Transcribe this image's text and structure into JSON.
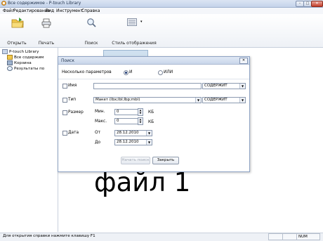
{
  "window": {
    "title": "Все содержимое - P-touch Library"
  },
  "menu": [
    "Файл",
    "Редактирование",
    "Вид",
    "Инструмент",
    "Справка"
  ],
  "toolbar": {
    "open_label": "Открыть",
    "print_label": "Печать",
    "search_label": "Поиск",
    "view_style_label": "Стиль отображения"
  },
  "tree": {
    "root": "P-touch Library",
    "items": [
      "Все содержим",
      "Корзина",
      "Результаты по"
    ]
  },
  "main": {
    "big_text": "файл 1"
  },
  "status": {
    "text": "Для открытия справки нажмите клавишу F1",
    "num": "NUM"
  },
  "dialog": {
    "title": "Поиск",
    "close_glyph": "✕",
    "multi_params_label": "Несколько параметров",
    "radio_and": "И",
    "radio_or": "ИЛИ",
    "name_label": "Имя",
    "name_value": "",
    "name_mode": "СОДЕРЖИТ",
    "type_label": "Тип",
    "type_value": "Макет (lbx;lbl;lbp;mbl)",
    "type_mode": "СОДЕРЖИТ",
    "size_label": "Размер",
    "min_label": "Мин.",
    "min_value": "0",
    "max_label": "Макс.",
    "max_value": "0",
    "kb": "КБ",
    "date_label": "Дата",
    "from_label": "От",
    "from_value": "28.12.2010",
    "to_label": "До",
    "to_value": "28.12.2010",
    "start_button": "Начать поиск",
    "close_button": "Закрыть"
  },
  "colors": {
    "accent": "#1f3a74",
    "titlebar": "#c4d3ea"
  }
}
